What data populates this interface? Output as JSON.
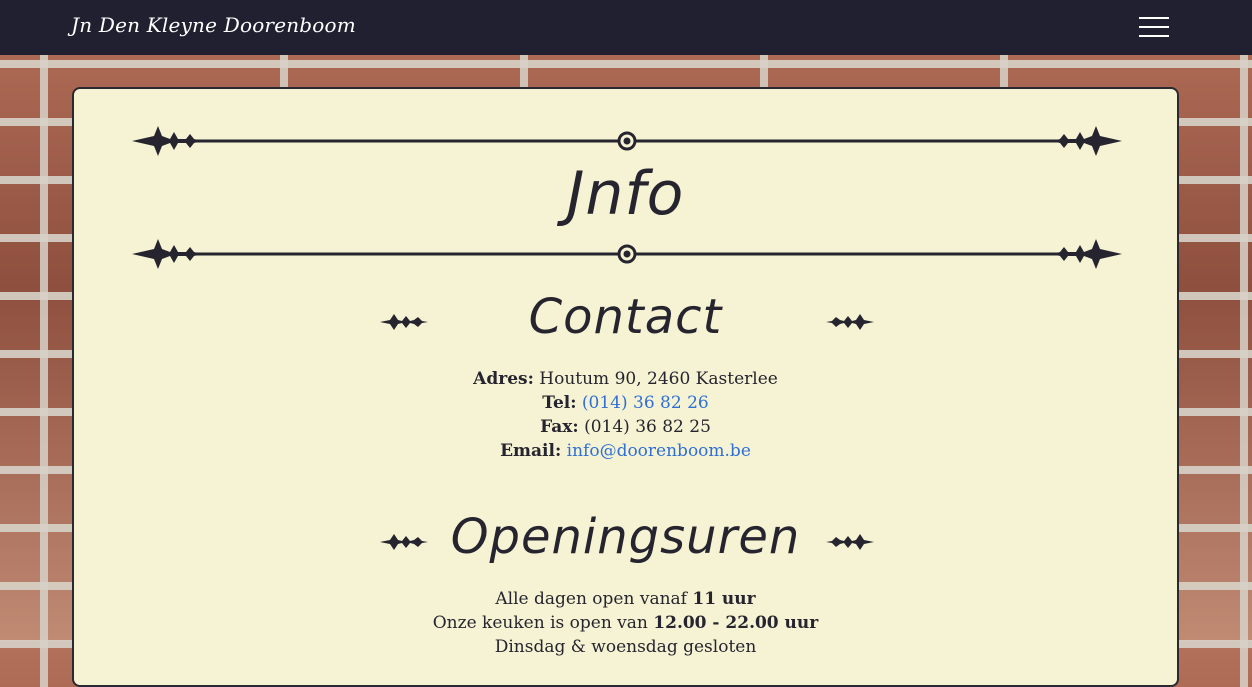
{
  "navbar": {
    "brand": "Jn Den Kleyne Doorenboom",
    "menu_icon": "hamburger-menu-icon"
  },
  "page": {
    "title": "Jnfo"
  },
  "contact": {
    "title": "Contact",
    "address_label": "Adres:",
    "address_value": "Houtum 90, 2460 Kasterlee",
    "tel_label": "Tel:",
    "tel_value": "(014) 36 82 26",
    "fax_label": "Fax:",
    "fax_value": "(014) 36 82 25",
    "email_label": "Email:",
    "email_value": "info@doorenboom.be"
  },
  "hours": {
    "title": "Openingsuren",
    "line1_prefix": "Alle dagen open vanaf",
    "line1_bold": "11 uur",
    "line2_prefix": "Onze keuken is open van",
    "line2_bold": "12.00 - 22.00 uur",
    "line3": "Dinsdag & woensdag gesloten"
  },
  "colors": {
    "navbar_bg": "#212031",
    "card_bg": "#f5f3d3",
    "text": "#26242e",
    "link": "#2f6fd6"
  }
}
